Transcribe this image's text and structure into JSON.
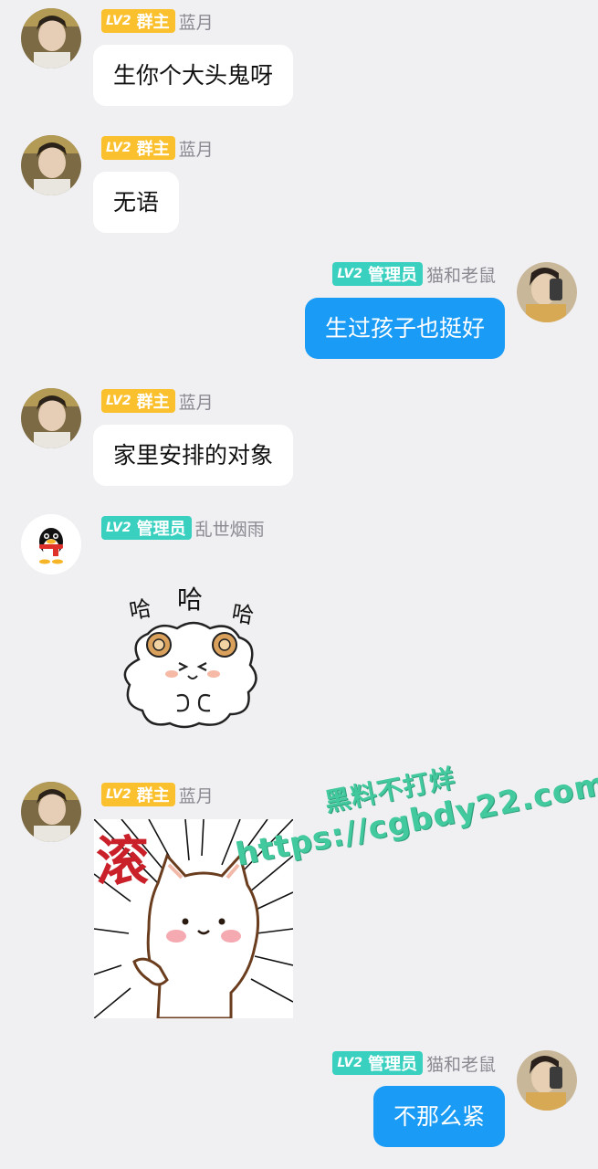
{
  "messages": [
    {
      "side": "left",
      "level": "LV2",
      "role": "群主",
      "name": "蓝月",
      "text": "生你个大头鬼呀"
    },
    {
      "side": "left",
      "level": "LV2",
      "role": "群主",
      "name": "蓝月",
      "text": "无语"
    },
    {
      "side": "right",
      "level": "LV2",
      "role": "管理员",
      "name": "猫和老鼠",
      "text": "生过孩子也挺好"
    },
    {
      "side": "left",
      "level": "LV2",
      "role": "群主",
      "name": "蓝月",
      "text": "家里安排的对象"
    },
    {
      "side": "left",
      "level": "LV2",
      "role": "管理员",
      "name": "乱世烟雨",
      "sticker": "laughing-sheep-sticker",
      "sticker_text": [
        "哈",
        "哈",
        "哈"
      ]
    },
    {
      "side": "left",
      "level": "LV2",
      "role": "群主",
      "name": "蓝月",
      "sticker": "cat-get-lost-sticker",
      "sticker_text": [
        "滚"
      ]
    },
    {
      "side": "right",
      "level": "LV2",
      "role": "管理员",
      "name": "猫和老鼠",
      "text": "不那么紧"
    }
  ],
  "watermark": {
    "line1": "黑料不打烊",
    "line2": "https://cgbdy22.com"
  },
  "colors": {
    "background": "#f0f0f2",
    "owner_badge": "#fbc02d",
    "admin_badge": "#3ad0c0",
    "outgoing_bubble": "#1a9bf5",
    "incoming_bubble": "#ffffff",
    "watermark": "#43c99e"
  }
}
